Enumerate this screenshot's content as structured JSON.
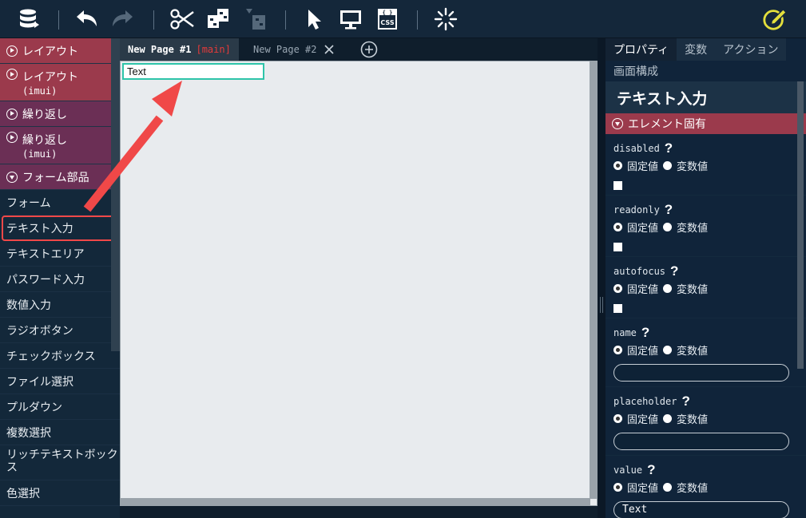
{
  "toolbar": {
    "icons": [
      "database-stack-icon",
      "undo-icon",
      "redo-icon",
      "scissors-cut-icon",
      "component-split-icon",
      "component-merge-icon",
      "cursor-icon",
      "monitor-preview-icon",
      "css-file-icon",
      "loading-spinner-icon",
      "edit-pen-icon"
    ],
    "css_label": "CSS"
  },
  "palette": {
    "categories": [
      {
        "label": "レイアウト",
        "sub": ""
      },
      {
        "label": "レイアウト",
        "sub": "(imui)"
      },
      {
        "label": "繰り返し",
        "sub": ""
      },
      {
        "label": "繰り返し",
        "sub": "(imui)"
      },
      {
        "label": "フォーム部品",
        "sub": ""
      }
    ],
    "items": [
      "フォーム",
      "テキスト入力",
      "テキストエリア",
      "パスワード入力",
      "数値入力",
      "ラジオボタン",
      "チェックボックス",
      "ファイル選択",
      "プルダウン",
      "複数選択",
      "リッチテキストボックス",
      "色選択"
    ],
    "selected_item": "テキスト入力"
  },
  "tabs": [
    {
      "label": "New Page #1",
      "branch": "[main]"
    },
    {
      "label": "New Page #2"
    }
  ],
  "canvas": {
    "text_component_value": "Text"
  },
  "right_panel": {
    "tabs": [
      "プロパティ",
      "変数",
      "アクション"
    ],
    "second_tab": "画面構成",
    "component_title": "テキスト入力",
    "section": "エレメント固有",
    "radio_fixed": "固定値",
    "radio_var": "変数値",
    "props": [
      {
        "name": "disabled"
      },
      {
        "name": "readonly"
      },
      {
        "name": "autofocus"
      },
      {
        "name": "name",
        "value": ""
      },
      {
        "name": "placeholder",
        "value": ""
      },
      {
        "name": "value",
        "value": "Text"
      }
    ]
  },
  "colors": {
    "accent_red": "#9b3a4c",
    "accent_purple": "#6b2f55",
    "selection_outline": "#f04848",
    "canvas_highlight": "#2ec4a9",
    "arrow": "#f04848"
  }
}
